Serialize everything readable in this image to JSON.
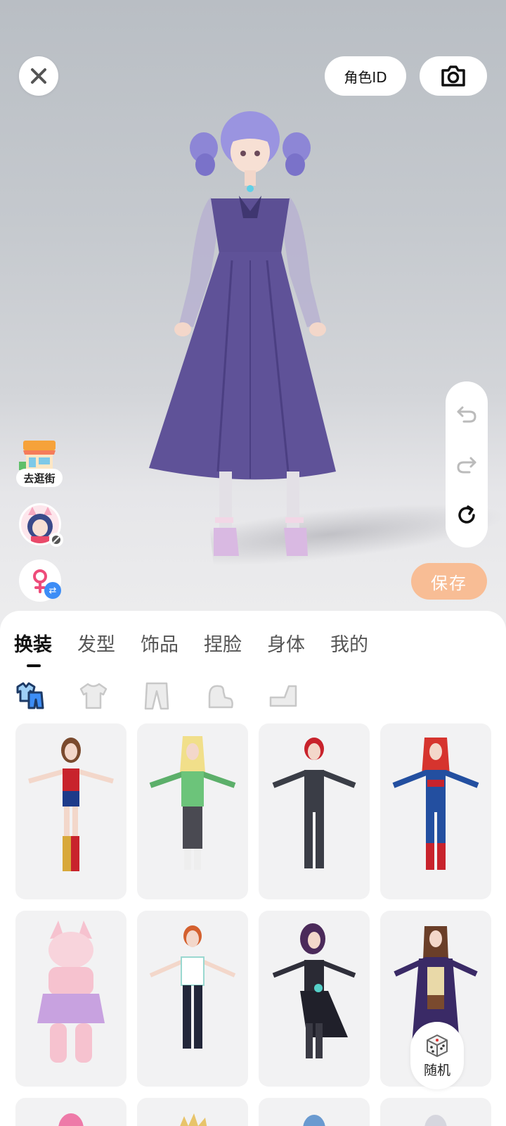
{
  "top": {
    "role_id_label": "角色ID"
  },
  "side": {
    "shop_label": "去逛街"
  },
  "actions": {
    "save_label": "保存",
    "random_label": "随机"
  },
  "tabs": [
    {
      "label": "换装",
      "active": true
    },
    {
      "label": "发型",
      "active": false
    },
    {
      "label": "饰品",
      "active": false
    },
    {
      "label": "捏脸",
      "active": false
    },
    {
      "label": "身体",
      "active": false
    },
    {
      "label": "我的",
      "active": false
    }
  ],
  "categories": [
    {
      "icon": "outfit-set-icon",
      "active": true
    },
    {
      "icon": "top-shirt-icon",
      "active": false
    },
    {
      "icon": "pants-icon",
      "active": false
    },
    {
      "icon": "socks-icon",
      "active": false
    },
    {
      "icon": "shoes-icon",
      "active": false
    }
  ],
  "colors": {
    "save_button": "#f8bd95",
    "swap_badge": "#3d8df6",
    "active_icon": "#3d8df6"
  }
}
